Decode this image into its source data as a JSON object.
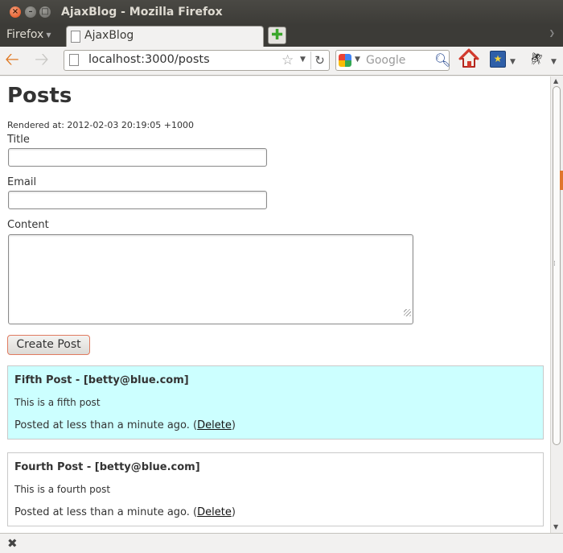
{
  "window": {
    "title": "AjaxBlog - Mozilla Firefox",
    "app_menu": "Firefox"
  },
  "tabs": [
    {
      "label": "AjaxBlog",
      "active": true
    }
  ],
  "toolbar": {
    "url": "localhost:3000/posts",
    "search_placeholder": "Google",
    "search_engine_icon": "google-icon",
    "icons": [
      "back-arrow-icon",
      "forward-arrow-icon",
      "page-icon",
      "bookmark-star-icon",
      "reload-icon",
      "search-icon",
      "home-icon",
      "bookmarks-icon",
      "bug-icon"
    ]
  },
  "page": {
    "heading": "Posts",
    "rendered_at": "Rendered at: 2012-02-03 20:19:05 +1000",
    "form": {
      "title_label": "Title",
      "title_value": "",
      "email_label": "Email",
      "email_value": "",
      "content_label": "Content",
      "content_value": "",
      "submit_label": "Create Post"
    },
    "posts": [
      {
        "title": "Fifth Post - [betty@blue.com]",
        "body": "This is a fifth post",
        "meta_prefix": "Posted at less than a minute ago. (",
        "delete_label": "Delete",
        "meta_suffix": ")",
        "highlight": "#ccffff"
      },
      {
        "title": "Fourth Post - [betty@blue.com]",
        "body": "This is a fourth post",
        "meta_prefix": "Posted at less than a minute ago. (",
        "delete_label": "Delete",
        "meta_suffix": ")",
        "highlight": "#ffffff"
      }
    ]
  },
  "colors": {
    "titlebar": "#3c3b37",
    "close_button": "#e04b16",
    "highlight_post": "#ccffff",
    "create_button_border": "#e07a5f"
  }
}
